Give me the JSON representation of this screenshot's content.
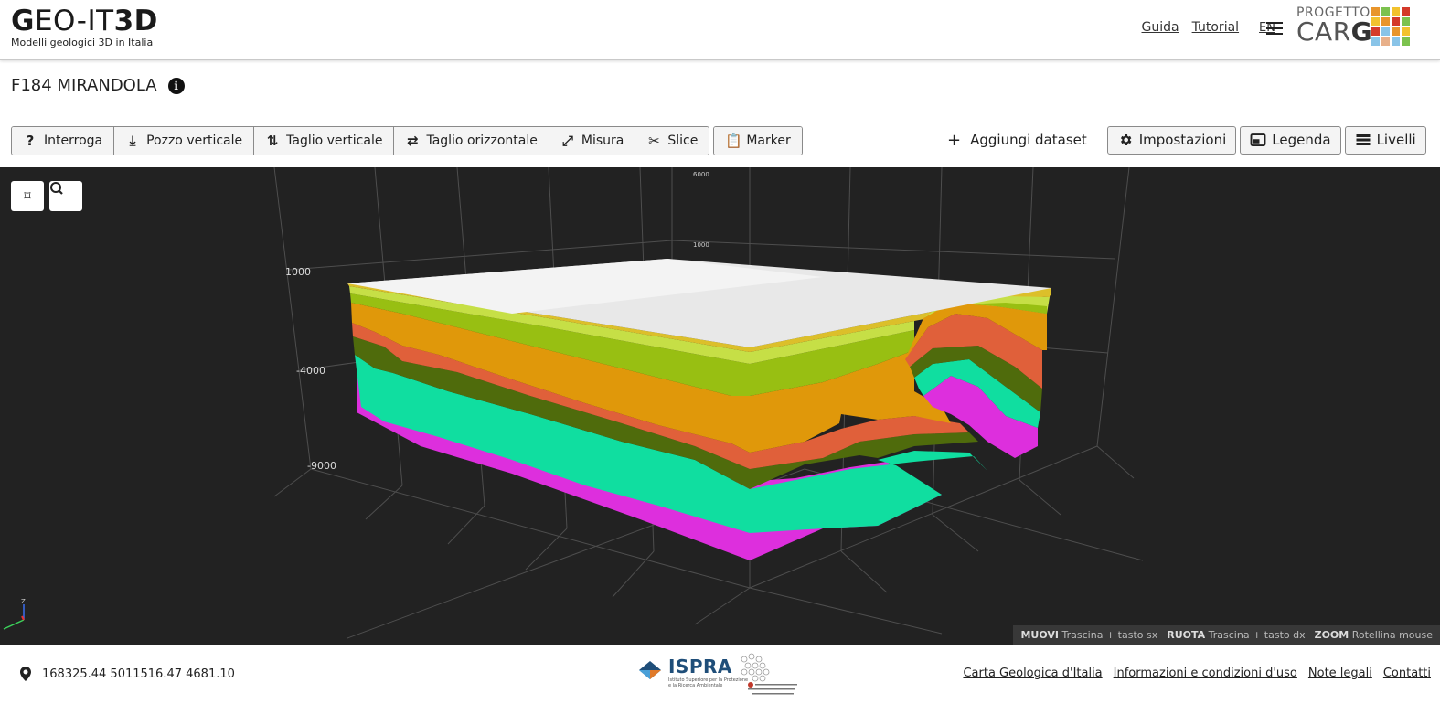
{
  "header": {
    "logo_part1": "G",
    "logo_part2": "EO-IT",
    "logo_part3": "3D",
    "logo_subtitle": "Modelli geologici 3D in Italia",
    "links": {
      "guida": "Guida",
      "tutorial": "Tutorial"
    },
    "language": "EN",
    "carg_top": "PROGETTO",
    "carg_main_light": "CAR",
    "carg_main_bold": "G"
  },
  "title": {
    "text": "F184 MIRANDOLA"
  },
  "toolbar": {
    "interroga": "Interroga",
    "pozzo": "Pozzo verticale",
    "taglio_v": "Taglio verticale",
    "taglio_o": "Taglio orizzontale",
    "misura": "Misura",
    "slice": "Slice",
    "marker": "Marker"
  },
  "right_toolbar": {
    "add_dataset": "Aggiungi dataset",
    "impostazioni": "Impostazioni",
    "legenda": "Legenda",
    "livelli": "Livelli"
  },
  "viewer": {
    "axis_labels": {
      "left_top": "1000",
      "left_mid": "-4000",
      "left_bottom": "-9000",
      "back_top": "6000",
      "back_mid": "1000",
      "cut": "6000"
    },
    "axes_gizmo": {
      "z": "Z"
    },
    "layer_colors": {
      "yellow": "#dcbf2a",
      "light_green": "#c6df46",
      "green": "#98bf12",
      "orange": "#e0980a",
      "red_orange": "#e0603a",
      "dark_green": "#4f6b0c",
      "teal": "#10dea0",
      "magenta": "#dd2fdd"
    },
    "hints": {
      "muovi_key": "MUOVI",
      "muovi_text": "Trascina + tasto sx",
      "ruota_key": "RUOTA",
      "ruota_text": "Trascina + tasto dx",
      "zoom_key": "ZOOM",
      "zoom_text": "Rotellina mouse"
    }
  },
  "footer": {
    "coordinates": "168325.44 5011516.47 4681.10",
    "ispra_name": "ISPRA",
    "ispra_sub1": "Istituto Superiore per la Protezione",
    "ispra_sub2": "e la Ricerca Ambientale",
    "links": {
      "carta": "Carta Geologica d'Italia",
      "info": "Informazioni e condizioni d'uso",
      "note": "Note legali",
      "contatti": "Contatti"
    }
  }
}
